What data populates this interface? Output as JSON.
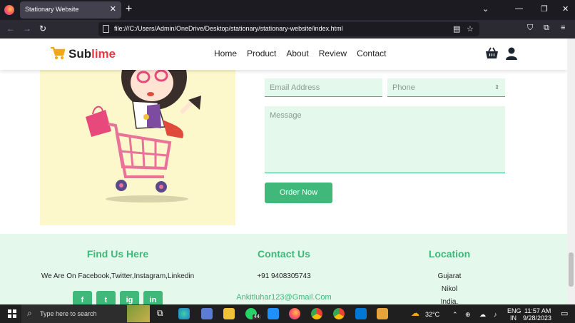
{
  "browser": {
    "tab_title": "Stationary Website",
    "url": "file:///C:/Users/Admin/OneDrive/Desktop/stationary/stationary-website/index.html"
  },
  "header": {
    "logo_part1": "Sub",
    "logo_part2": "lime",
    "nav": [
      "Home",
      "Product",
      "About",
      "Review",
      "Contact"
    ]
  },
  "form": {
    "email_placeholder": "Email Address",
    "phone_placeholder": "Phone",
    "message_placeholder": "Message",
    "submit_label": "Order Now"
  },
  "footer": {
    "find_title": "Find Us Here",
    "find_text": "We Are On Facebook,Twitter,Instagram,Linkedin",
    "contact_title": "Contact Us",
    "phone": "+91 9408305743",
    "email": "Ankitluhar123@Gmail.Com",
    "location_title": "Location",
    "locations": [
      "Gujarat",
      "Nikol",
      "India."
    ],
    "socials": [
      "f",
      "t",
      "ig",
      "in"
    ]
  },
  "taskbar": {
    "search_placeholder": "Type here to search",
    "badge_count": "44",
    "weather": "32°C",
    "lang_1": "ENG",
    "lang_2": "IN",
    "time": "11:57 AM",
    "date": "9/28/2023"
  },
  "colors": {
    "accent": "#3fb87a",
    "accent_light": "#e4f9ec",
    "logo_red": "#e63946",
    "illustration_bg": "#fdf8cb"
  }
}
